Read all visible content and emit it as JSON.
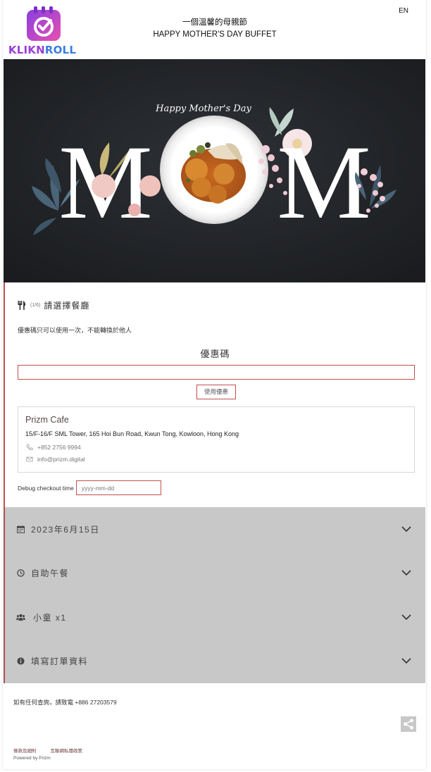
{
  "brand": {
    "logo_text_part1": "KLIKN",
    "logo_text_part2": "ROLL",
    "accent_purple": "#9b3fd6",
    "accent_blue": "#3b7de0"
  },
  "header": {
    "title_zh": "一個溫馨的母親節",
    "title_en": "HAPPY MOTHER'S DAY BUFFET",
    "lang_toggle": "EN"
  },
  "hero": {
    "script_text": "Happy Mother's Day",
    "big_letters": [
      "M",
      "M"
    ]
  },
  "step": {
    "icon": "fork-knife-icon",
    "counter": "(1/6)",
    "title": "請選擇餐廳"
  },
  "coupon": {
    "note": "優惠碼只可以使用一次，不能轉換於他人",
    "title": "優惠碼",
    "input_value": "",
    "button_label": "使用優惠"
  },
  "restaurant": {
    "name": "Prizm Cafe",
    "address": "15/F-16/F SML Tower, 165 Hoi Bun Road, Kwun Tong, Kowloon, Hong Kong",
    "phone": "+852 2756 9994",
    "email": "info@prizm.digital"
  },
  "debug": {
    "label": "Debug checkout time",
    "placeholder": "yyyy-mm-dd"
  },
  "accordions": [
    {
      "icon": "calendar-icon",
      "label": "2023年6月15日"
    },
    {
      "icon": "clock-icon",
      "label": "自助午餐"
    },
    {
      "icon": "users-icon",
      "label": "小童 x1"
    },
    {
      "icon": "info-icon",
      "label": "填寫訂單資料"
    }
  ],
  "footer": {
    "contact": "如有任何查詢，請致電 +886 27203579",
    "link_terms": "條款及細則",
    "link_privacy": "互聯網私隱政策",
    "powered_by": "Powered by Prizm",
    "share_icon": "share-icon"
  },
  "colors": {
    "border_red": "#c0504d",
    "accordion_bg": "#c8c8c8",
    "hero_bg": "#23262a"
  }
}
